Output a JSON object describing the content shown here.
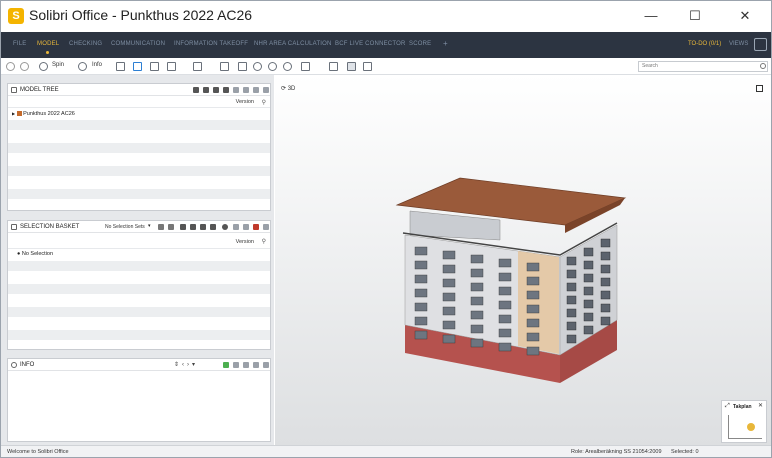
{
  "window": {
    "app_title": "Solibri Office - Punkthus 2022 AC26",
    "logo_letter": "S",
    "controls": {
      "minimize": "—",
      "maximize": "☐",
      "close": "✕"
    }
  },
  "menubar": {
    "tabs": [
      {
        "label": "FILE"
      },
      {
        "label": "MODEL",
        "active": true
      },
      {
        "label": "CHECKING"
      },
      {
        "label": "COMMUNICATION"
      },
      {
        "label": "INFORMATION TAKEOFF"
      },
      {
        "label": "NHR AREA CALCULATION"
      },
      {
        "label": "BCF LIVE CONNECTOR"
      },
      {
        "label": "SCORE"
      },
      {
        "label": "+"
      }
    ],
    "todo": "TO-DO (0/1)",
    "views": "VIEWS"
  },
  "toolbar": {
    "spin_label": "Spin",
    "info_label": "Info",
    "search_placeholder": "Search"
  },
  "model_tree": {
    "title": "MODEL TREE",
    "version_col": "Version",
    "root_item": "Punkthus 2022 AC26"
  },
  "selection_basket": {
    "title": "SELECTION BASKET",
    "sets_dropdown": "No Selection Sets",
    "version_col": "Version",
    "empty_item": "No Selection"
  },
  "info_panel": {
    "title": "INFO"
  },
  "viewport": {
    "label": "3D",
    "minimap_label": "Takplan"
  },
  "statusbar": {
    "welcome": "Welcome to Solibri Office",
    "role": "Role: Arealberäkning SS 21054:2009",
    "selected": "Selected: 0"
  },
  "colors": {
    "menubar_bg": "#2c3441",
    "accent": "#e8b73a",
    "roof": "#9a5a3a",
    "facade": "#dcdde0",
    "base": "#b4544f"
  }
}
